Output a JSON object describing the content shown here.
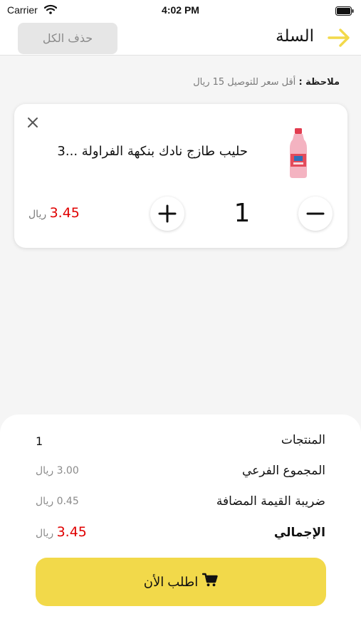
{
  "status_bar": {
    "carrier": "Carrier",
    "time": "4:02 PM"
  },
  "header": {
    "title": "السلة",
    "delete_all_label": "حذف الكل",
    "accent_color": "#f2d94a"
  },
  "note": {
    "label": "ملاحظة :",
    "text": "أقل سعر للتوصيل 15 ريال"
  },
  "cart_item": {
    "name": "حليب طازج نادك بنكهة الفراولة ...3",
    "quantity": "1",
    "price": "3.45",
    "currency": "ريال",
    "image_icon": "strawberry-milk-bottle"
  },
  "summary": {
    "rows": [
      {
        "label": "المنتجات",
        "value": "1"
      },
      {
        "label": "المجموع الفرعي",
        "value": "3.00",
        "currency": "ريال"
      },
      {
        "label": "ضريبة القيمة المضافة",
        "value": "0.45",
        "currency": "ريال"
      }
    ],
    "total": {
      "label": "الإجمالي",
      "value": "3.45",
      "currency": "ريال"
    },
    "order_label": "اطلب الأن",
    "price_color": "#e00000"
  }
}
